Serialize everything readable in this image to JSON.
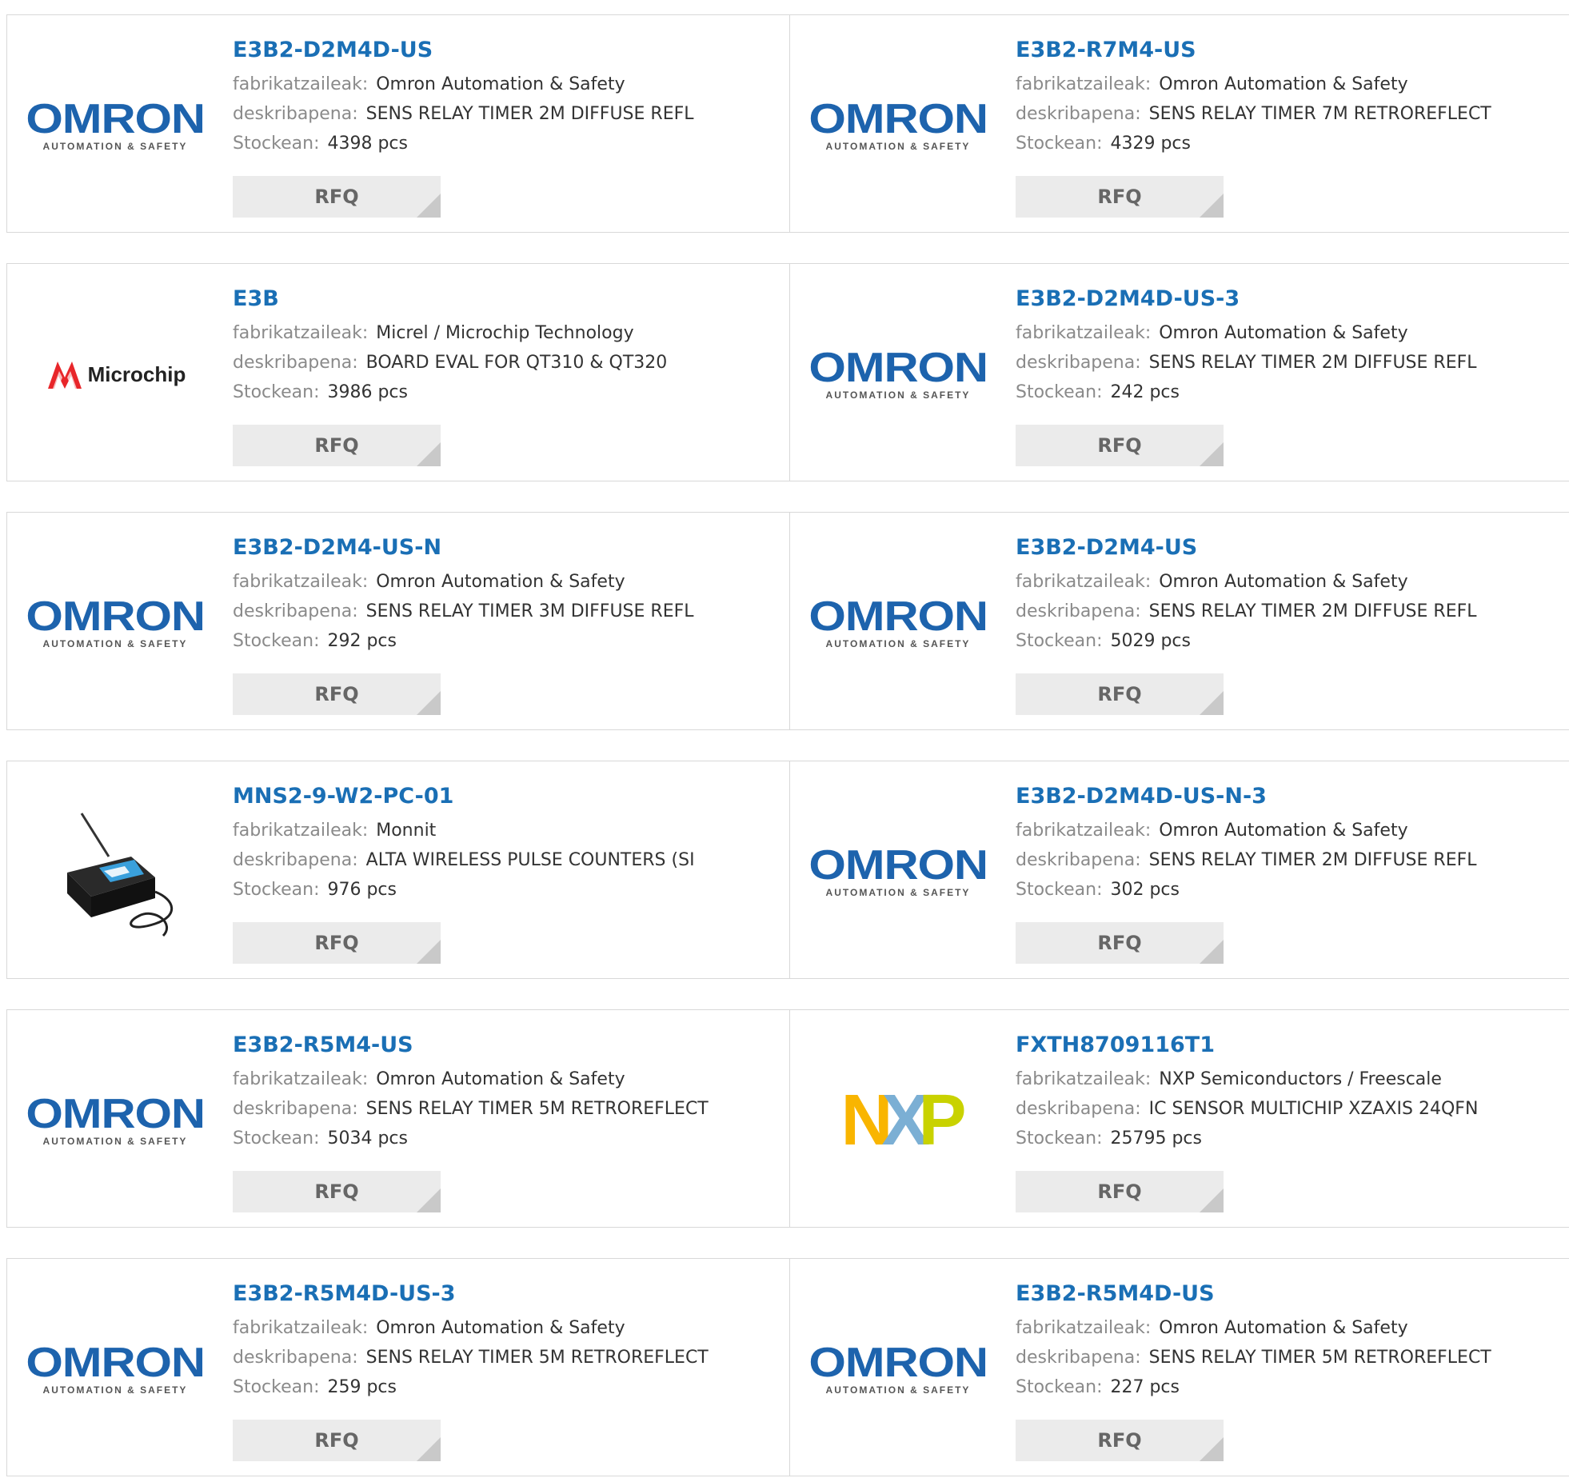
{
  "labels": {
    "manufacturer": "fabrikatzaileak:",
    "description": "deskribapena:",
    "stock": "Stockean:",
    "rfq": "RFQ"
  },
  "logos": {
    "omron_word": "OMRON",
    "omron_sub": "AUTOMATION & SAFETY",
    "microchip_word": "Microchip",
    "nxp_letters": [
      "N",
      "X",
      "P"
    ],
    "nxp_colors": [
      "#f9b500",
      "#7bafd4",
      "#c9d200"
    ],
    "omron_color": "#1d63ad",
    "microchip_color": "#e8262a"
  },
  "colors": {
    "part_number": "#1a6fb5",
    "label": "#8a8a8a",
    "value": "#333333",
    "rfq_bg": "#ebebeb"
  },
  "products": [
    {
      "pn": "E3B2-D2M4D-US",
      "logo": "omron",
      "manufacturer": "Omron Automation & Safety",
      "description": "SENS RELAY TIMER 2M DIFFUSE REFL",
      "stock": "4398 pcs"
    },
    {
      "pn": "E3B2-R7M4-US",
      "logo": "omron",
      "manufacturer": "Omron Automation & Safety",
      "description": "SENS RELAY TIMER 7M RETROREFLECT",
      "stock": "4329 pcs"
    },
    {
      "pn": "E3B",
      "logo": "microchip",
      "manufacturer": "Micrel / Microchip Technology",
      "description": "BOARD EVAL FOR QT310 & QT320",
      "stock": "3986 pcs"
    },
    {
      "pn": "E3B2-D2M4D-US-3",
      "logo": "omron",
      "manufacturer": "Omron Automation & Safety",
      "description": "SENS RELAY TIMER 2M DIFFUSE REFL",
      "stock": "242 pcs"
    },
    {
      "pn": "E3B2-D2M4-US-N",
      "logo": "omron",
      "manufacturer": "Omron Automation & Safety",
      "description": "SENS RELAY TIMER 3M DIFFUSE REFL",
      "stock": "292 pcs"
    },
    {
      "pn": "E3B2-D2M4-US",
      "logo": "omron",
      "manufacturer": "Omron Automation & Safety",
      "description": "SENS RELAY TIMER 2M DIFFUSE REFL",
      "stock": "5029 pcs"
    },
    {
      "pn": "MNS2-9-W2-PC-01",
      "logo": "device",
      "manufacturer": "Monnit",
      "description": "ALTA WIRELESS PULSE COUNTERS (SI",
      "stock": "976 pcs"
    },
    {
      "pn": "E3B2-D2M4D-US-N-3",
      "logo": "omron",
      "manufacturer": "Omron Automation & Safety",
      "description": "SENS RELAY TIMER 2M DIFFUSE REFL",
      "stock": "302 pcs"
    },
    {
      "pn": "E3B2-R5M4-US",
      "logo": "omron",
      "manufacturer": "Omron Automation & Safety",
      "description": "SENS RELAY TIMER 5M RETROREFLECT",
      "stock": "5034 pcs"
    },
    {
      "pn": "FXTH8709116T1",
      "logo": "nxp",
      "manufacturer": "NXP Semiconductors / Freescale",
      "description": "IC SENSOR MULTICHIP XZAXIS 24QFN",
      "stock": "25795 pcs"
    },
    {
      "pn": "E3B2-R5M4D-US-3",
      "logo": "omron",
      "manufacturer": "Omron Automation & Safety",
      "description": "SENS RELAY TIMER 5M RETROREFLECT",
      "stock": "259 pcs"
    },
    {
      "pn": "E3B2-R5M4D-US",
      "logo": "omron",
      "manufacturer": "Omron Automation & Safety",
      "description": "SENS RELAY TIMER 5M RETROREFLECT",
      "stock": "227 pcs"
    }
  ]
}
